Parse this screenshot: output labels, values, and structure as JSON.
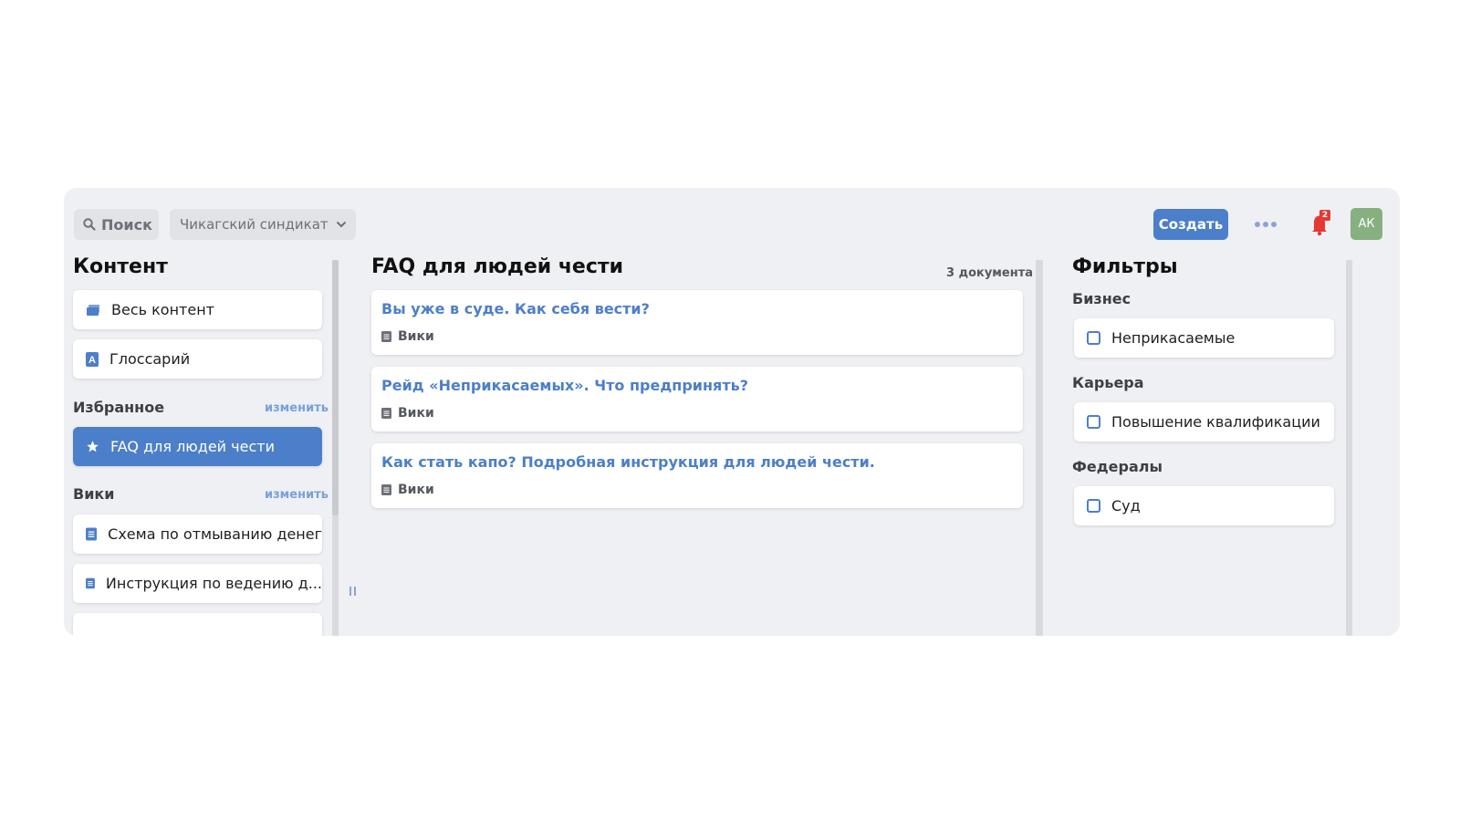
{
  "header": {
    "search_label": "Поиск",
    "workspace_label": "Чикагский синдикат",
    "create_label": "Создать",
    "notifications_count": "2",
    "avatar_initials": "АК"
  },
  "sidebar": {
    "title": "Контент",
    "top_items": [
      {
        "label": "Весь контент",
        "icon": "folder-icon"
      },
      {
        "label": "Глоссарий",
        "icon": "glossary-icon"
      }
    ],
    "favorites": {
      "label": "Избранное",
      "edit_label": "изменить",
      "items": [
        {
          "label": "FAQ для людей чести",
          "icon": "star-icon"
        }
      ]
    },
    "wiki": {
      "label": "Вики",
      "edit_label": "изменить",
      "items": [
        {
          "label": "Схема по отмыванию денег",
          "icon": "document-icon"
        },
        {
          "label": "Инструкция по ведению д...",
          "icon": "document-icon"
        }
      ]
    }
  },
  "main": {
    "title": "FAQ для людей чести",
    "doc_count": "3 документа",
    "documents": [
      {
        "title": "Вы уже в суде. Как себя вести?",
        "type": "Вики"
      },
      {
        "title": "Рейд «Неприкасаемых». Что предпринять?",
        "type": "Вики"
      },
      {
        "title": "Как стать капо? Подробная инструкция для людей чести.",
        "type": "Вики"
      }
    ]
  },
  "filters": {
    "title": "Фильтры",
    "groups": [
      {
        "label": "Бизнес",
        "option": "Неприкасаемые"
      },
      {
        "label": "Карьера",
        "option": "Повышение квалификации"
      },
      {
        "label": "Федералы",
        "option": "Суд"
      }
    ]
  },
  "colors": {
    "accent": "#4c7fc9",
    "background": "#eff0f3",
    "badge": "#e53935",
    "avatar": "#86b07f"
  }
}
